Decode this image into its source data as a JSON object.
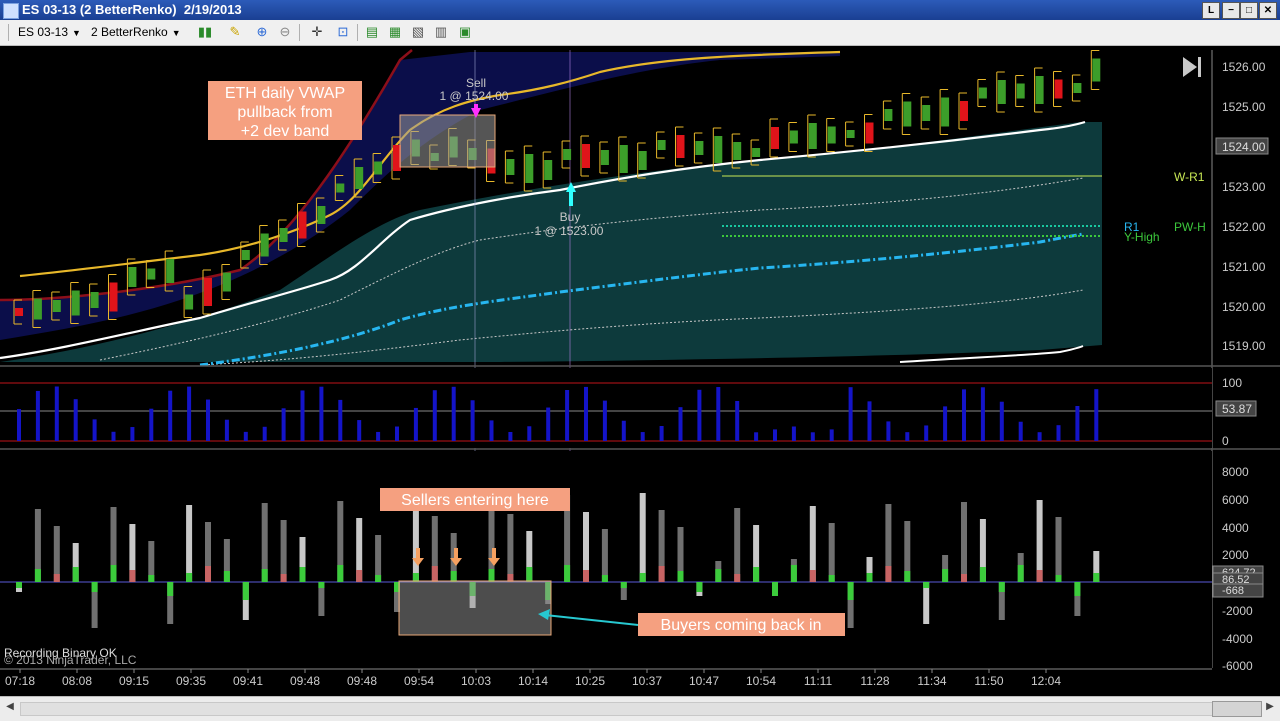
{
  "window": {
    "title": "ES 03-13 (2 BetterRenko)  2/19/2013",
    "buttons": [
      "L",
      "−",
      "□",
      "✕"
    ]
  },
  "toolbar": {
    "instrument": "ES 03-13",
    "bar_type": "2 BetterRenko",
    "icons": [
      "candlestick-style-icon",
      "draw-pencil-icon",
      "zoom-in-icon",
      "zoom-out-icon",
      "crosshair-icon",
      "data-box-icon",
      "indicators-icon",
      "strategies-icon",
      "chart-properties-icon",
      "bar-chart-icon",
      "save-icon"
    ]
  },
  "price_panel": {
    "y_ticks": [
      "1526.00",
      "1525.00",
      "1524.00",
      "1523.00",
      "1522.00",
      "1521.00",
      "1520.00",
      "1519.00"
    ],
    "last_price": "1524.00",
    "sell_label": "Sell",
    "sell_detail": "1 @ 1524.00",
    "buy_label": "Buy",
    "buy_detail": "1 @ 1523.00",
    "annotation": [
      "ETH daily VWAP",
      "pullback from",
      "+2 dev band"
    ],
    "level_labels": {
      "wr1": "W-R1",
      "r1": "R1",
      "yhigh": "Y-High",
      "pwh": "PW-H"
    },
    "colors": {
      "up": "#3c9e2a",
      "down": "#e0141a",
      "vwap": "#ffffff",
      "upper_band": "#e8b82a",
      "outer_band": "#8c0f1a",
      "lower_band": "#27b6f0",
      "band_fill": "#0d3a3c",
      "cloud": "#0b0e4a"
    }
  },
  "osc_panel": {
    "y_ticks": [
      "100",
      "0"
    ],
    "last_value": "53.87",
    "bar_color": "#1414c8"
  },
  "delta_panel": {
    "y_ticks": [
      "8000",
      "6000",
      "4000",
      "2000",
      "0",
      "-2000",
      "-4000",
      "-6000"
    ],
    "value_labels": [
      "624.72",
      "86.52",
      "-668"
    ],
    "sellers_note": "Sellers entering here",
    "buyers_note": "Buyers coming back in"
  },
  "x_axis": {
    "labels": [
      "07:18",
      "08:08",
      "09:15",
      "09:35",
      "09:41",
      "09:48",
      "09:48",
      "09:54",
      "10:03",
      "10:14",
      "10:25",
      "10:37",
      "10:47",
      "10:54",
      "11:11",
      "11:28",
      "11:34",
      "11:50",
      "12:04"
    ]
  },
  "footer": {
    "status": "Recording Binary OK",
    "copyright": "© 2013 NinjaTrader, LLC"
  }
}
